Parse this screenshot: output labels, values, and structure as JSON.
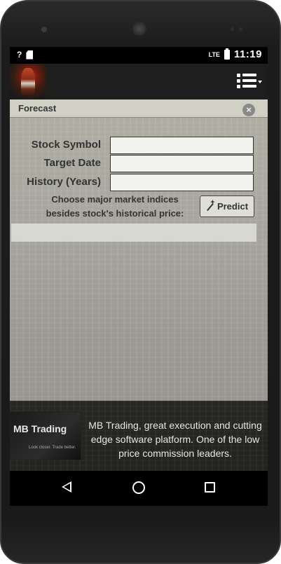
{
  "status_bar": {
    "left_signal": "?",
    "network": "LTE",
    "time": "11:19"
  },
  "action_bar": {
    "menu_icon": "list-menu-icon"
  },
  "dialog": {
    "title": "Forecast",
    "close_icon": "close-icon"
  },
  "form": {
    "stock_symbol_label": "Stock Symbol",
    "stock_symbol_value": "",
    "target_date_label": "Target Date",
    "target_date_value": "",
    "history_label": "History (Years)",
    "history_value": "",
    "indices_text_line1": "Choose major market indices",
    "indices_text_line2": "besides stock's historical price:",
    "predict_label": "Predict"
  },
  "ad": {
    "logo_text": "MB Trading",
    "logo_tagline": "Look closer. Trade better.",
    "text": "MB Trading, great execution and cutting edge software platform. One of the low price commission leaders."
  },
  "colors": {
    "overlay": "#e8e8e0",
    "label": "#333333",
    "navbar": "#000000"
  }
}
